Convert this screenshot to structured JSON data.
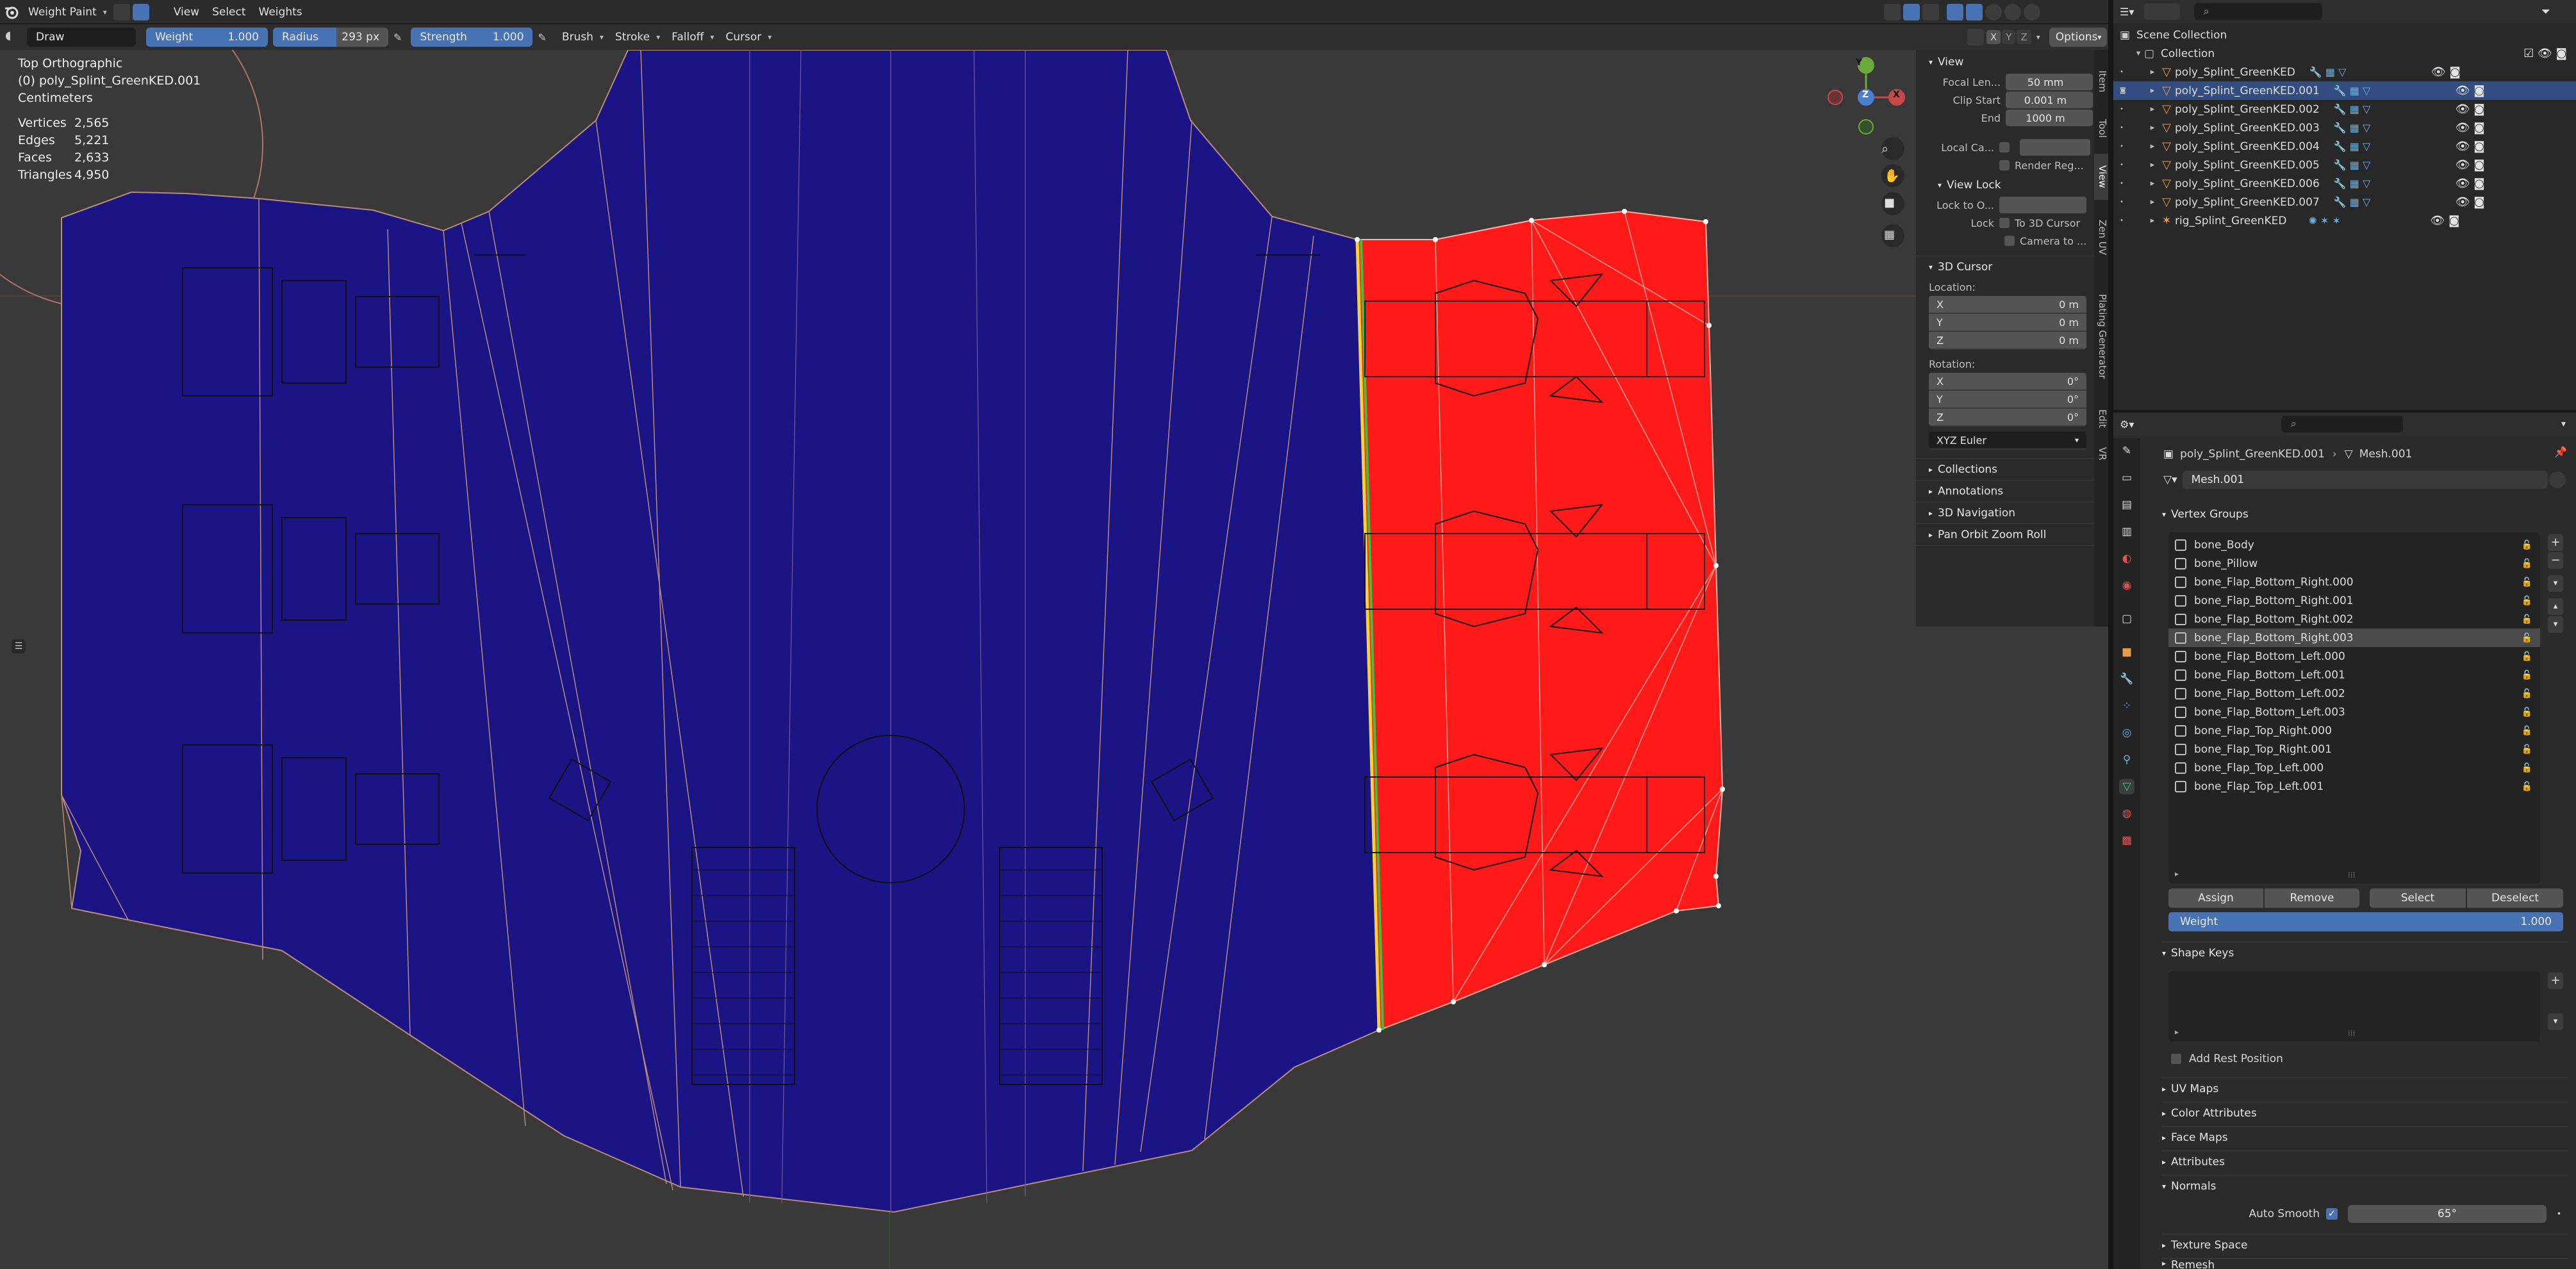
{
  "header": {
    "mode": "Weight Paint",
    "menus": [
      "View",
      "Select",
      "Weights"
    ],
    "options": "Options",
    "xyz": [
      "X",
      "Y",
      "Z"
    ]
  },
  "toolbar": {
    "tool": "Draw",
    "weight_label": "Weight",
    "weight_value": "1.000",
    "radius_label": "Radius",
    "radius_value": "293 px",
    "strength_label": "Strength",
    "strength_value": "1.000",
    "brush": "Brush",
    "stroke": "Stroke",
    "falloff": "Falloff",
    "cursor": "Cursor"
  },
  "viewport": {
    "view_name": "Top Orthographic",
    "object_name": "(0) poly_Splint_GreenKED.001",
    "units": "Centimeters",
    "stats": [
      {
        "label": "Vertices",
        "value": "2,565"
      },
      {
        "label": "Edges",
        "value": "5,221"
      },
      {
        "label": "Faces",
        "value": "2,633"
      },
      {
        "label": "Triangles",
        "value": "4,950"
      }
    ],
    "gizmo": {
      "y": "Y",
      "x": "X",
      "z": "Z"
    },
    "colors": {
      "background": "#393939",
      "zero_weight": "#1a1484",
      "full_weight": "#ff1a1a",
      "gradient_edge": "#3fcf3f",
      "wire": "#111111"
    }
  },
  "npanel": {
    "view_header": "View",
    "focal_label": "Focal Len...",
    "focal_value": "50 mm",
    "clip_start_label": "Clip Start",
    "clip_start_value": "0.001 m",
    "end_label": "End",
    "end_value": "1000 m",
    "local_camera_label": "Local Ca...",
    "render_region": "Render Reg...",
    "view_lock_header": "View Lock",
    "lock_to_label": "Lock to O...",
    "lock_label": "Lock",
    "to_3d_cursor": "To 3D Cursor",
    "camera_to": "Camera to ...",
    "cursor_header": "3D Cursor",
    "location_label": "Location:",
    "location": [
      {
        "axis": "X",
        "value": "0 m"
      },
      {
        "axis": "Y",
        "value": "0 m"
      },
      {
        "axis": "Z",
        "value": "0 m"
      }
    ],
    "rotation_label": "Rotation:",
    "rotation": [
      {
        "axis": "X",
        "value": "0°"
      },
      {
        "axis": "Y",
        "value": "0°"
      },
      {
        "axis": "Z",
        "value": "0°"
      }
    ],
    "rotation_mode": "XYZ Euler",
    "collapsed": [
      "Collections",
      "Annotations",
      "3D Navigation",
      "Pan Orbit Zoom Roll"
    ],
    "side_tabs": [
      "Item",
      "Tool",
      "View",
      "Zen UV",
      "Plating Generator",
      "Edit",
      "VR"
    ]
  },
  "outliner": {
    "scene_collection": "Scene Collection",
    "collection": "Collection",
    "items": [
      {
        "name": "poly_Splint_GreenKED",
        "selected": false
      },
      {
        "name": "poly_Splint_GreenKED.001",
        "selected": true
      },
      {
        "name": "poly_Splint_GreenKED.002",
        "selected": false
      },
      {
        "name": "poly_Splint_GreenKED.003",
        "selected": false
      },
      {
        "name": "poly_Splint_GreenKED.004",
        "selected": false
      },
      {
        "name": "poly_Splint_GreenKED.005",
        "selected": false
      },
      {
        "name": "poly_Splint_GreenKED.006",
        "selected": false
      },
      {
        "name": "poly_Splint_GreenKED.007",
        "selected": false
      },
      {
        "name": "rig_Splint_GreenKED",
        "selected": false
      }
    ]
  },
  "properties": {
    "object_name": "poly_Splint_GreenKED.001",
    "mesh_name": "Mesh.001",
    "mesh_field": "Mesh.001",
    "vertex_groups_header": "Vertex Groups",
    "vertex_groups": [
      "bone_Body",
      "bone_Pillow",
      "bone_Flap_Bottom_Right.000",
      "bone_Flap_Bottom_Right.001",
      "bone_Flap_Bottom_Right.002",
      "bone_Flap_Bottom_Right.003",
      "bone_Flap_Bottom_Left.000",
      "bone_Flap_Bottom_Left.001",
      "bone_Flap_Bottom_Left.002",
      "bone_Flap_Bottom_Left.003",
      "bone_Flap_Top_Right.000",
      "bone_Flap_Top_Right.001",
      "bone_Flap_Top_Left.000",
      "bone_Flap_Top_Left.001"
    ],
    "selected_group_index": 5,
    "assign": "Assign",
    "remove": "Remove",
    "select": "Select",
    "deselect": "Deselect",
    "weight_label": "Weight",
    "weight_value": "1.000",
    "shape_keys_header": "Shape Keys",
    "add_rest_position": "Add Rest Position",
    "uv_maps": "UV Maps",
    "color_attributes": "Color Attributes",
    "face_maps": "Face Maps",
    "attributes": "Attributes",
    "normals": "Normals",
    "auto_smooth_label": "Auto Smooth",
    "auto_smooth_value": "65°",
    "texture_space": "Texture Space",
    "remesh": "Remesh"
  }
}
